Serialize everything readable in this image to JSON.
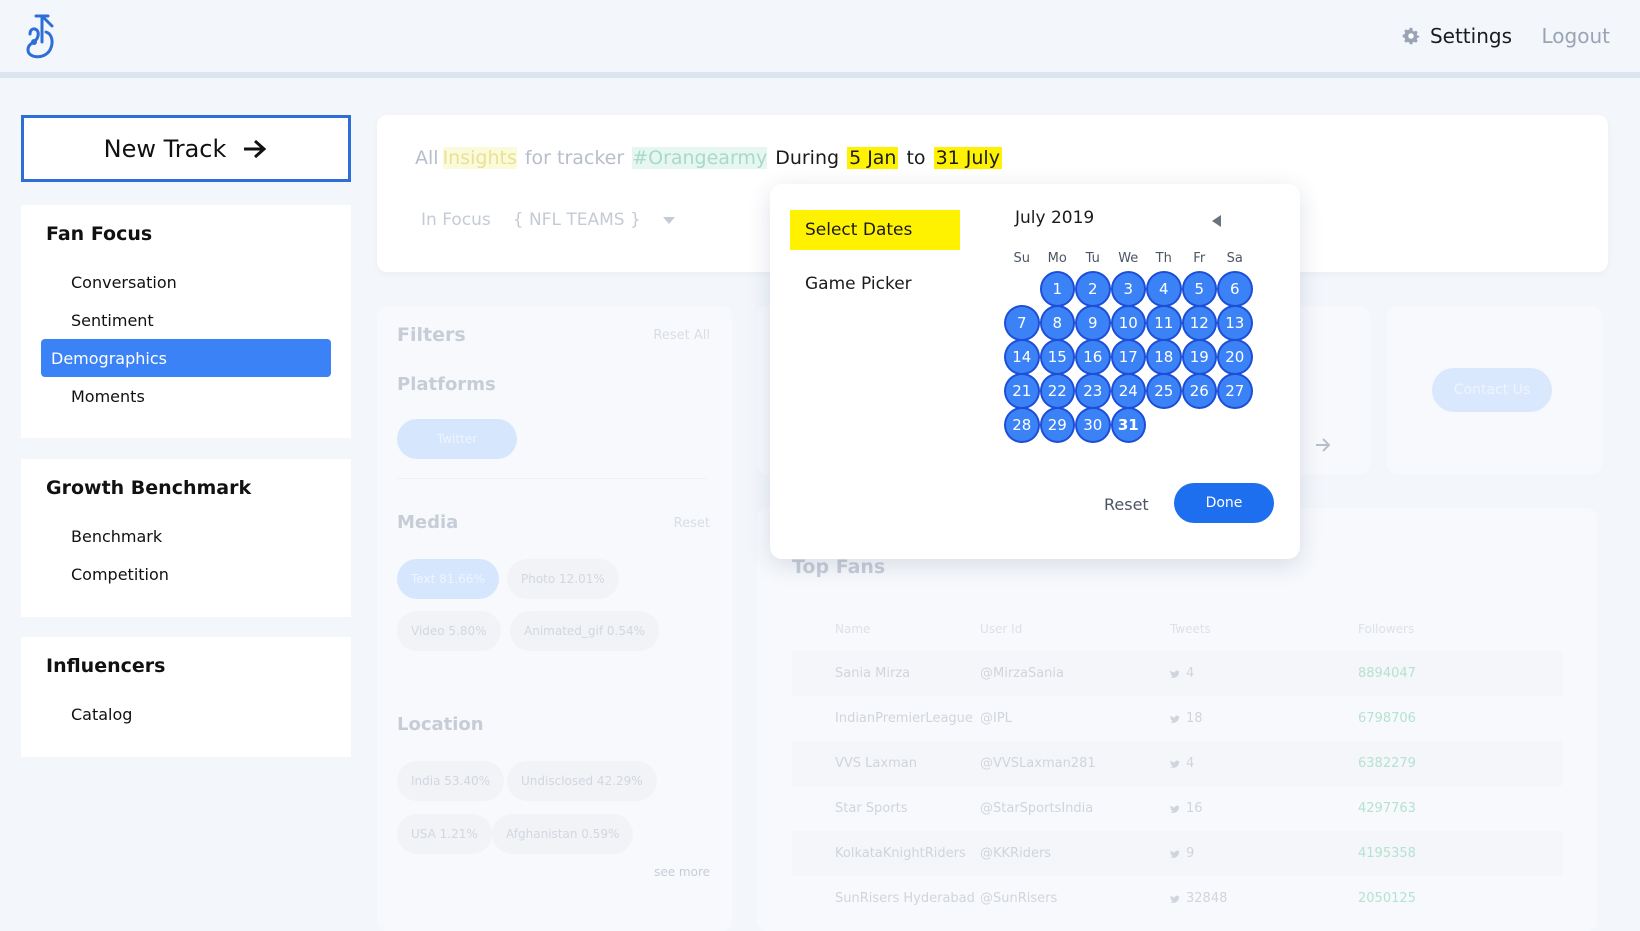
{
  "header": {
    "settings_label": "Settings",
    "logout_label": "Logout"
  },
  "sidebar": {
    "new_track_label": "New Track",
    "sections": [
      {
        "title": "Fan Focus",
        "items": [
          {
            "label": "Conversation"
          },
          {
            "label": "Sentiment"
          },
          {
            "label": "Demographics",
            "active": true
          },
          {
            "label": "Moments"
          }
        ]
      },
      {
        "title": "Growth Benchmark",
        "items": [
          {
            "label": "Benchmark"
          },
          {
            "label": "Competition"
          }
        ]
      },
      {
        "title": "Influencers",
        "items": [
          {
            "label": "Catalog"
          }
        ]
      }
    ]
  },
  "insight": {
    "all": "All",
    "insights": "Insights",
    "for_tracker": "for tracker",
    "tracker": "#Orangearmy",
    "during": "During",
    "from": "5 Jan",
    "to": "to",
    "until": "31 July",
    "in_focus": "In Focus",
    "focus_value": "{ NFL TEAMS }"
  },
  "filters": {
    "title": "Filters",
    "reset_all": "Reset All",
    "platforms_title": "Platforms",
    "platform_chip": "Twitter",
    "media_title": "Media",
    "media_reset": "Reset",
    "media_chips": [
      "Text  81.66%",
      "Photo  12.01%",
      "Video  5.80%",
      "Animated_gif  0.54%"
    ],
    "location_title": "Location",
    "location_chips": [
      "India  53.40%",
      "Undisclosed  42.29%",
      "USA  1.21%",
      "Afghanistan  0.59%"
    ],
    "see_more": "see more"
  },
  "contact_label": "Contact Us",
  "top_fans": {
    "title": "Top Fans",
    "columns": [
      "Name",
      "User Id",
      "Tweets",
      "Followers"
    ],
    "rows": [
      [
        "Sania Mirza",
        "@MirzaSania",
        "4",
        "8894047"
      ],
      [
        "IndianPremierLeague",
        "@IPL",
        "18",
        "6798706"
      ],
      [
        "VVS Laxman",
        "@VVSLaxman281",
        "4",
        "6382279"
      ],
      [
        "Star Sports",
        "@StarSportsIndia",
        "16",
        "4297763"
      ],
      [
        "KolkataKnightRiders",
        "@KKRiders",
        "9",
        "4195358"
      ],
      [
        "SunRisers Hyderabad",
        "@SunRisers",
        "32848",
        "2050125"
      ]
    ]
  },
  "picker": {
    "select_dates": "Select Dates",
    "game_picker": "Game Picker",
    "month_title": "July 2019",
    "weekdays": [
      "Su",
      "Mo",
      "Tu",
      "We",
      "Th",
      "Fr",
      "Sa"
    ],
    "first_weekday_offset": 1,
    "days_in_month": 31,
    "selected_day": 31,
    "reset_label": "Reset",
    "done_label": "Done"
  }
}
